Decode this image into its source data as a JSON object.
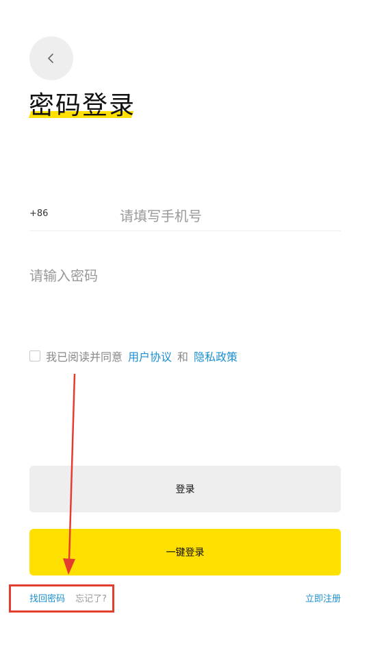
{
  "header": {
    "back_icon": "chevron-left-icon",
    "title": "密码登录"
  },
  "form": {
    "country_code": "+86",
    "phone_placeholder": "请填写手机号",
    "password_placeholder": "请输入密码"
  },
  "agreement": {
    "checked": false,
    "text": "我已阅读并同意",
    "user_agreement": "用户协议",
    "and": "和",
    "privacy_policy": "隐私政策"
  },
  "buttons": {
    "login": "登录",
    "quick_login": "一键登录"
  },
  "footer": {
    "retrieve_password": "找回密码",
    "forgot_hint": "忘记了?",
    "register": "立即注册"
  },
  "colors": {
    "accent_yellow": "#ffe000",
    "link_blue": "#1a8fd0",
    "annotation_red": "#e43d30",
    "button_gray": "#eeeeee"
  }
}
